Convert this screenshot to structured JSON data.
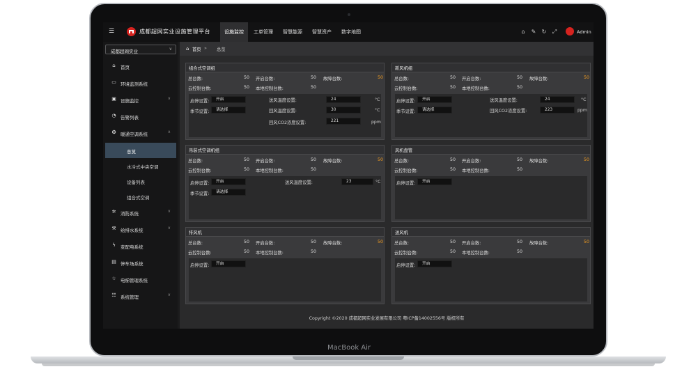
{
  "header": {
    "title": "成都超网实业设施管理平台",
    "nav": [
      "设施监控",
      "工单管理",
      "智慧能源",
      "智慧资产",
      "数字地图"
    ],
    "active_nav": "设施监控",
    "user": "Admin"
  },
  "device": {
    "label": "MacBook Air"
  },
  "sidebar": {
    "org": "成都超网实业",
    "items": [
      {
        "label": "首页",
        "icon": "home-icon"
      },
      {
        "label": "环境监测系统",
        "icon": "monitor-icon"
      },
      {
        "label": "设施监控",
        "icon": "device-icon"
      },
      {
        "label": "告警列表",
        "icon": "alarm-icon"
      },
      {
        "label": "暖通空调系统",
        "icon": "hvac-icon"
      },
      {
        "label": "消防系统",
        "icon": "fire-icon"
      },
      {
        "label": "给排水系统",
        "icon": "water-icon"
      },
      {
        "label": "变配电系统",
        "icon": "power-icon"
      },
      {
        "label": "停车场系统",
        "icon": "parking-icon"
      },
      {
        "label": "电梯管理系统",
        "icon": "elevator-icon"
      },
      {
        "label": "系统管理",
        "icon": "settings-icon"
      }
    ],
    "sub_items": [
      "总览",
      "水冷式中央空调",
      "设备列表",
      "组合式空调"
    ]
  },
  "breadcrumb": {
    "home": "首页",
    "current": "总览"
  },
  "labels": {
    "total": "总台数:",
    "open": "开启台数:",
    "fault": "故障台数:",
    "remote": "云控制台数:",
    "local": "本地控制台数:",
    "start_stop": "启停设置:",
    "season": "季节设置:",
    "supply_temp": "送风温度设置:",
    "return_temp": "回风温度设置:",
    "return_co2": "回风CO2浓度设置:",
    "start_value": "开启",
    "season_value": "请选择",
    "unit_c": "°C",
    "unit_ppm": "ppm"
  },
  "cards": [
    {
      "title": "组合式空调组",
      "total": "50",
      "open": "50",
      "fault": "50",
      "remote": "50",
      "local": "50",
      "supply_temp": "24",
      "return_temp": "30",
      "return_co2": "221"
    },
    {
      "title": "新风机组",
      "total": "50",
      "open": "50",
      "fault": "50",
      "remote": "50",
      "local": "50",
      "supply_temp": "24",
      "return_co2": "223"
    },
    {
      "title": "吊装式空调机组",
      "total": "50",
      "open": "50",
      "fault": "50",
      "remote": "50",
      "local": "50",
      "supply_temp": "23"
    },
    {
      "title": "风机盘管",
      "total": "50",
      "open": "50",
      "fault": "50",
      "remote": "50",
      "local": "50"
    },
    {
      "title": "排风机",
      "total": "50",
      "open": "50",
      "fault": "50",
      "remote": "50",
      "local": "50"
    },
    {
      "title": "送风机",
      "total": "50",
      "open": "50",
      "fault": "50",
      "remote": "50",
      "local": "50"
    }
  ],
  "colors": {
    "alert": "#f39c1f",
    "brand": "#d6231f",
    "active_sub": "#394a5a"
  },
  "footer": "Copyright ©2020 成都超网实业发展有限公司 粤ICP备14002556号 版权所有"
}
